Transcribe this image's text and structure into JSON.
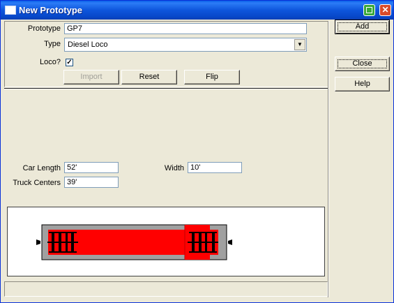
{
  "window": {
    "title": "New Prototype"
  },
  "form": {
    "prototype_label": "Prototype",
    "prototype_value": "GP7",
    "type_label": "Type",
    "type_value": "Diesel Loco",
    "loco_label": "Loco?",
    "loco_checked": "✓"
  },
  "buttons": {
    "import": "Import",
    "reset": "Reset",
    "flip": "Flip",
    "add": "Add",
    "close": "Close",
    "help": "Help"
  },
  "dimensions": {
    "car_length_label": "Car Length",
    "car_length_value": "52'",
    "width_label": "Width",
    "width_value": "10'",
    "truck_centers_label": "Truck Centers",
    "truck_centers_value": "39'"
  },
  "colors": {
    "body": "#ff0000",
    "car_frame": "#a0a0a0",
    "truck": "#000000"
  }
}
